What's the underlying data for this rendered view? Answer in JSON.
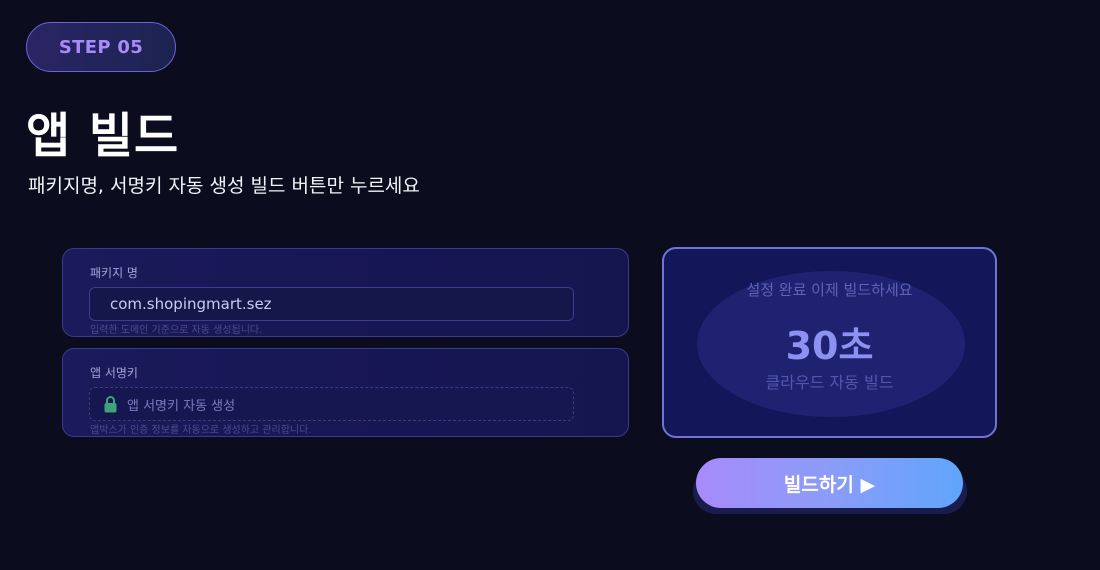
{
  "step": {
    "label": "STEP 05"
  },
  "header": {
    "title": "앱 빌드",
    "subtitle": "패키지명, 서명키 자동 생성 빌드 버튼만 누르세요"
  },
  "package_field": {
    "label": "패키지 명",
    "value": "com.shopingmart.sez",
    "help": "입력한 도메인 기준으로 자동 생성됩니다."
  },
  "sign_field": {
    "label": "앱 서명키",
    "icon": "lock-icon",
    "placeholder": "앱 서명키 자동 생성",
    "help": "앱박스가 인증 정보를 자동으로 생성하고 관리합니다."
  },
  "build_panel": {
    "status": "설정 완료 이제 빌드하세요",
    "time": "30초",
    "caption": "클라우드 자동 빌드"
  },
  "build_button": {
    "label": "빌드하기 ▶"
  },
  "colors": {
    "background": "#0b0c1d",
    "accent_purple": "#a78bfa",
    "accent_blue": "#60a5fa",
    "lock_green": "#3ea37a"
  }
}
